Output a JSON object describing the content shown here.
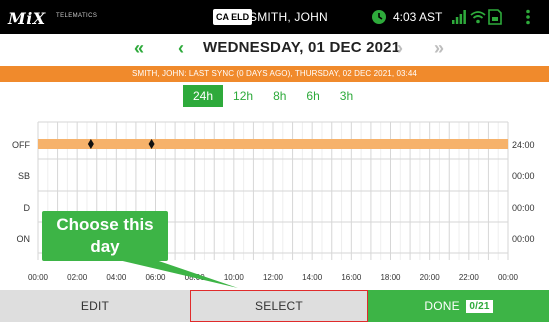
{
  "statusbar": {
    "logo": "MiX",
    "logo_sub": "TELEMATICS",
    "eld_badge": "CA ELD",
    "driver_name": "SMITH, JOHN",
    "time": "4:03 AST",
    "icons": [
      "clock-icon",
      "signal-icon",
      "wifi-icon",
      "sim-icon",
      "overflow-menu-icon"
    ]
  },
  "datenav": {
    "first_label": "«",
    "prev_label": "‹",
    "title": "WEDNESDAY, 01 DEC 2021",
    "next_label": "›",
    "last_label": "»"
  },
  "sync_text": "SMITH, JOHN: LAST SYNC (0 DAYS AGO), THURSDAY, 02 DEC 2021, 03:44",
  "zoom_tabs": [
    "24h",
    "12h",
    "8h",
    "6h",
    "3h"
  ],
  "zoom_selected": "24h",
  "chart_data": {
    "type": "table",
    "rows": [
      "OFF",
      "SB",
      "D",
      "ON"
    ],
    "x_ticks": [
      "00:00",
      "02:00",
      "04:00",
      "06:00",
      "08:00",
      "10:00",
      "12:00",
      "14:00",
      "16:00",
      "18:00",
      "20:00",
      "22:00",
      "00:00"
    ],
    "x_range_hours": [
      0,
      24
    ],
    "segments": [
      {
        "status": "OFF",
        "start_hour": 0,
        "end_hour": 24
      }
    ],
    "markers": [
      {
        "status": "OFF",
        "hour": 2.7
      },
      {
        "status": "OFF",
        "hour": 5.8
      }
    ],
    "totals": [
      "24:00",
      "00:00",
      "00:00",
      "00:00"
    ],
    "colors": {
      "off_bar": "#f6b26b",
      "grid": "#dddddd",
      "marker": "#111111"
    }
  },
  "callout": {
    "text": "Choose this day"
  },
  "bottom": {
    "edit_label": "EDIT",
    "select_label": "SELECT",
    "done_label": "DONE",
    "done_count": "0/21"
  },
  "colors": {
    "accent": "#2eaa3b",
    "sync_bar": "#f08a2c",
    "select_border": "#e02b2b"
  }
}
